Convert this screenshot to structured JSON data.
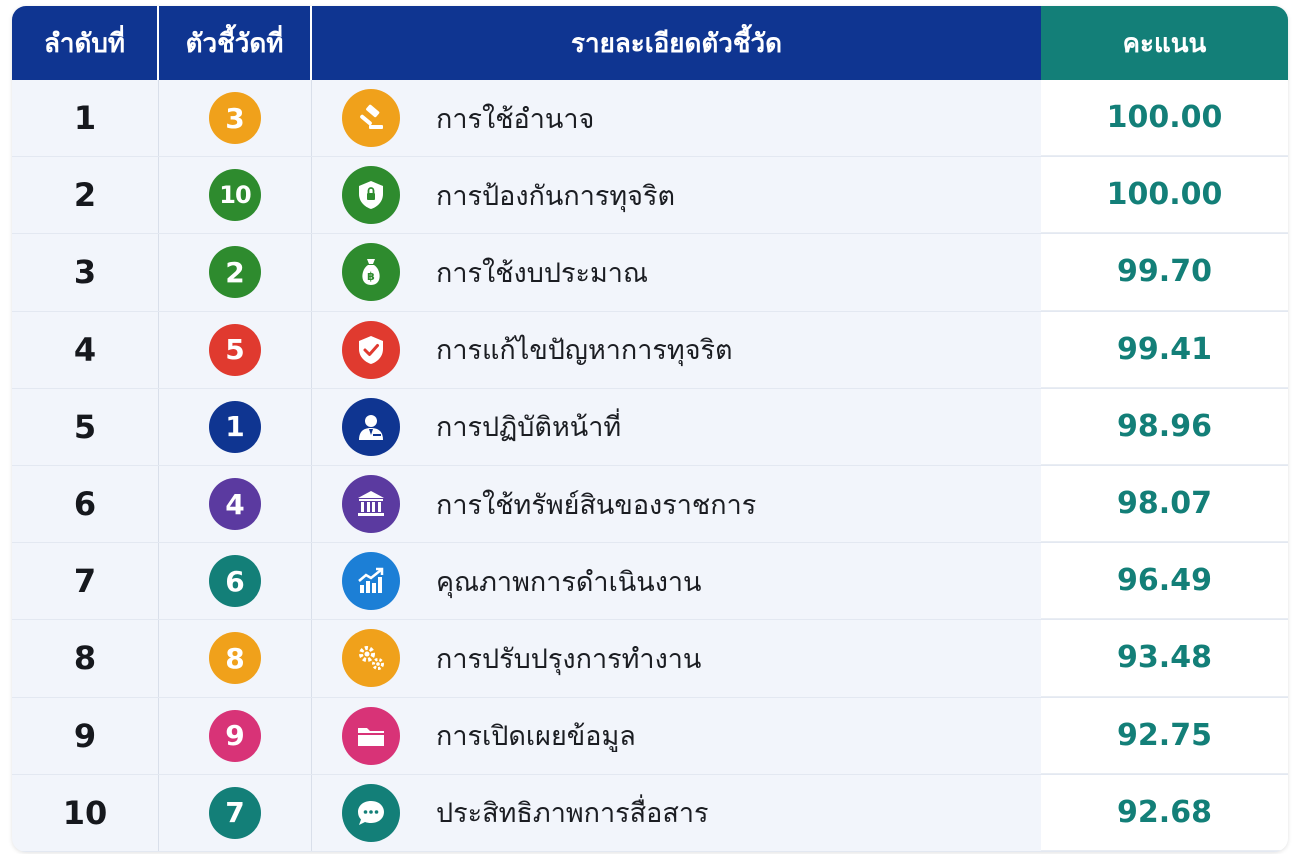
{
  "header": {
    "rank": "ลำดับที่",
    "indicator": "ตัวชี้วัดที่",
    "detail": "รายละเอียดตัวชี้วัด",
    "score": "คะแนน"
  },
  "colors": {
    "header_blue": "#0f3591",
    "header_teal": "#137f78",
    "score_text": "#137f78"
  },
  "rows": [
    {
      "rank": "1",
      "indicator": "3",
      "badge_color": "#f0a11b",
      "icon": "gavel-icon",
      "icon_color": "#f0a11b",
      "detail": "การใช้อำนาจ",
      "score": "100.00"
    },
    {
      "rank": "2",
      "indicator": "10",
      "badge_color": "#2e8b2e",
      "icon": "shield-lock-icon",
      "icon_color": "#2e8b2e",
      "detail": "การป้องกันการทุจริต",
      "score": "100.00"
    },
    {
      "rank": "3",
      "indicator": "2",
      "badge_color": "#2e8b2e",
      "icon": "money-bag-icon",
      "icon_color": "#2e8b2e",
      "detail": "การใช้งบประมาณ",
      "score": "99.70"
    },
    {
      "rank": "4",
      "indicator": "5",
      "badge_color": "#e03a2f",
      "icon": "shield-check-icon",
      "icon_color": "#e03a2f",
      "detail": "การแก้ไขปัญหาการทุจริต",
      "score": "99.41"
    },
    {
      "rank": "5",
      "indicator": "1",
      "badge_color": "#0f3591",
      "icon": "officer-icon",
      "icon_color": "#0f3591",
      "detail": "การปฏิบัติหน้าที่",
      "score": "98.96"
    },
    {
      "rank": "6",
      "indicator": "4",
      "badge_color": "#5b3aa0",
      "icon": "building-icon",
      "icon_color": "#5b3aa0",
      "detail": "การใช้ทรัพย์สินของราชการ",
      "score": "98.07"
    },
    {
      "rank": "7",
      "indicator": "6",
      "badge_color": "#137f78",
      "icon": "growth-chart-icon",
      "icon_color": "#1c7fd6",
      "detail": "คุณภาพการดำเนินงาน",
      "score": "96.49"
    },
    {
      "rank": "8",
      "indicator": "8",
      "badge_color": "#f0a11b",
      "icon": "gears-icon",
      "icon_color": "#f0a11b",
      "detail": "การปรับปรุงการทำงาน",
      "score": "93.48"
    },
    {
      "rank": "9",
      "indicator": "9",
      "badge_color": "#d83377",
      "icon": "folder-icon",
      "icon_color": "#d83377",
      "detail": "การเปิดเผยข้อมูล",
      "score": "92.75"
    },
    {
      "rank": "10",
      "indicator": "7",
      "badge_color": "#137f78",
      "icon": "chat-bubble-icon",
      "icon_color": "#137f78",
      "detail": "ประสิทธิภาพการสื่อสาร",
      "score": "92.68"
    }
  ]
}
